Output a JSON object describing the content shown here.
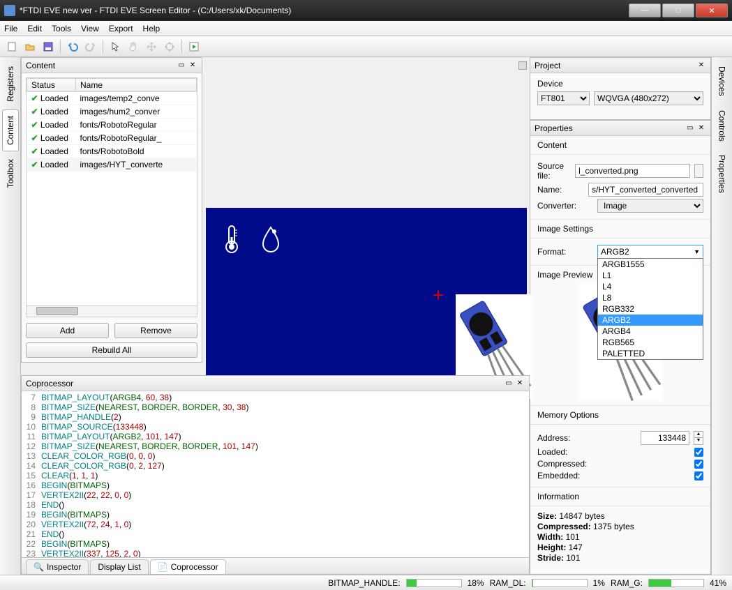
{
  "window": {
    "title": "*FTDI EVE new ver - FTDI EVE Screen Editor - (C:/Users/xk/Documents)"
  },
  "menubar": [
    "File",
    "Edit",
    "Tools",
    "View",
    "Export",
    "Help"
  ],
  "vtabs_left": [
    "Registers",
    "Content",
    "Toolbox"
  ],
  "vtabs_right": [
    "Devices",
    "Controls",
    "Properties"
  ],
  "content_panel": {
    "title": "Content",
    "columns": [
      "Status",
      "Name"
    ],
    "rows": [
      {
        "status": "Loaded",
        "name": "images/temp2_conve"
      },
      {
        "status": "Loaded",
        "name": "images/hum2_conver"
      },
      {
        "status": "Loaded",
        "name": "fonts/RobotoRegular"
      },
      {
        "status": "Loaded",
        "name": "fonts/RobotoRegular_"
      },
      {
        "status": "Loaded",
        "name": "fonts/RobotoBold"
      },
      {
        "status": "Loaded",
        "name": "images/HYT_converte"
      }
    ],
    "btn_add": "Add",
    "btn_remove": "Remove",
    "btn_rebuild": "Rebuild All"
  },
  "project": {
    "title": "Project",
    "device_label": "Device",
    "device": "FT801",
    "resolution": "WQVGA (480x272)"
  },
  "properties": {
    "title": "Properties",
    "content_hdr": "Content",
    "source_file_label": "Source file:",
    "source_file": "l_converted.png",
    "name_label": "Name:",
    "name": "s/HYT_converted_converted",
    "converter_label": "Converter:",
    "converter": "Image",
    "image_settings_hdr": "Image Settings",
    "format_label": "Format:",
    "format": "ARGB2",
    "format_options": [
      "ARGB1555",
      "L1",
      "L4",
      "L8",
      "RGB332",
      "ARGB2",
      "ARGB4",
      "RGB565",
      "PALETTED"
    ],
    "image_preview_hdr": "Image Preview",
    "memory_hdr": "Memory Options",
    "address_label": "Address:",
    "address": "133448",
    "loaded_label": "Loaded:",
    "loaded": true,
    "compressed_label": "Compressed:",
    "compressed": true,
    "embedded_label": "Embedded:",
    "embedded": true,
    "info_hdr": "Information",
    "info_size_label": "Size:",
    "info_size": "14847 bytes",
    "info_compressed_label": "Compressed:",
    "info_compressed": "1375 bytes",
    "info_width_label": "Width:",
    "info_width": "101",
    "info_height_label": "Height:",
    "info_height": "147",
    "info_stride_label": "Stride:",
    "info_stride": "101"
  },
  "coprocessor": {
    "title": "Coprocessor",
    "lines": [
      {
        "n": 7,
        "t": "BITMAP_LAYOUT(ARGB4, 60, 38)"
      },
      {
        "n": 8,
        "t": "BITMAP_SIZE(NEAREST, BORDER, BORDER, 30, 38)"
      },
      {
        "n": 9,
        "t": "BITMAP_HANDLE(2)"
      },
      {
        "n": 10,
        "t": "BITMAP_SOURCE(133448)"
      },
      {
        "n": 11,
        "t": "BITMAP_LAYOUT(ARGB2, 101, 147)"
      },
      {
        "n": 12,
        "t": "BITMAP_SIZE(NEAREST, BORDER, BORDER, 101, 147)"
      },
      {
        "n": 13,
        "t": "CLEAR_COLOR_RGB(0, 0, 0)"
      },
      {
        "n": 14,
        "t": "CLEAR_COLOR_RGB(0, 2, 127)"
      },
      {
        "n": 15,
        "t": "CLEAR(1, 1, 1)"
      },
      {
        "n": 16,
        "t": "BEGIN(BITMAPS)"
      },
      {
        "n": 17,
        "t": "VERTEX2II(22, 22, 0, 0)"
      },
      {
        "n": 18,
        "t": "END()"
      },
      {
        "n": 19,
        "t": "BEGIN(BITMAPS)"
      },
      {
        "n": 20,
        "t": "VERTEX2II(72, 24, 1, 0)"
      },
      {
        "n": 21,
        "t": "END()"
      },
      {
        "n": 22,
        "t": "BEGIN(BITMAPS)"
      },
      {
        "n": 23,
        "t": "VERTEX2II(337, 125, 2, 0)"
      }
    ]
  },
  "bottom_tabs": [
    "Inspector",
    "Display List",
    "Coprocessor"
  ],
  "statusbar": {
    "bitmap_handle_label": "BITMAP_HANDLE:",
    "bitmap_handle_pct": "18%",
    "ram_dl_label": "RAM_DL:",
    "ram_dl_pct": "1%",
    "ram_g_label": "RAM_G:",
    "ram_g_pct": "41%"
  }
}
